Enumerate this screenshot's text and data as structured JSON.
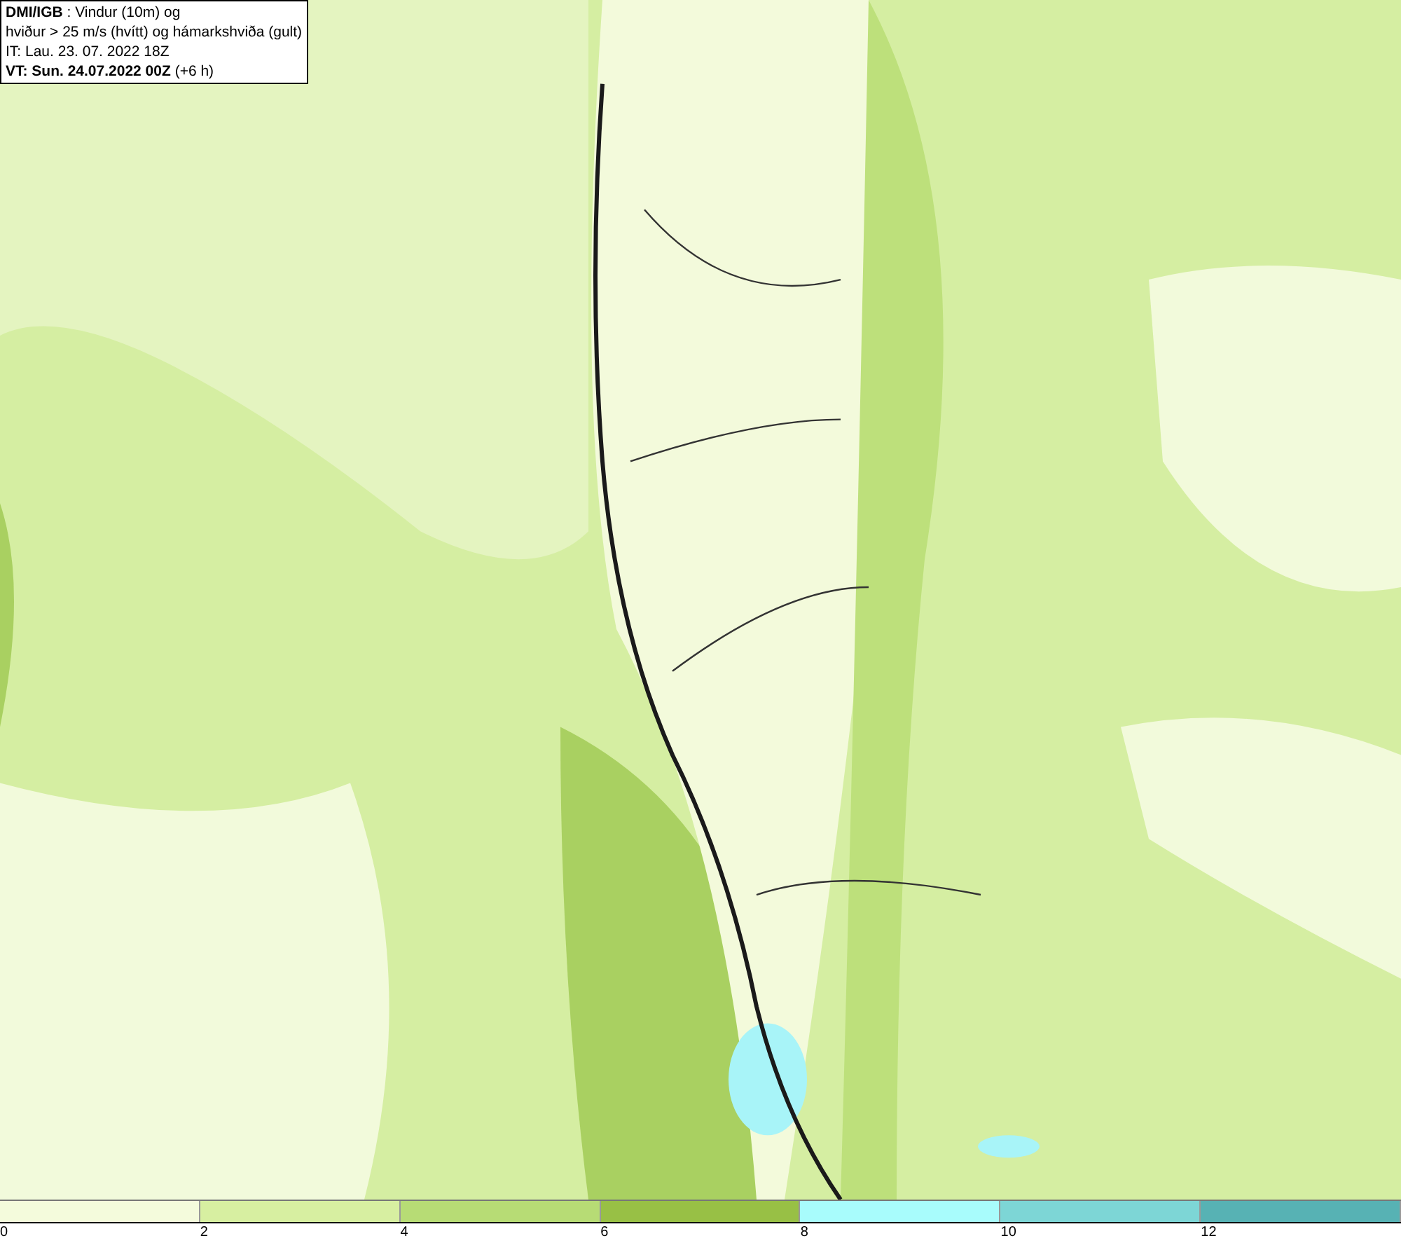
{
  "info": {
    "lines": [
      "**DMI/IGB** : Vindur (10m) og",
      "hviður > 25 m/s (hvítt) og hámarkshviða (gult)",
      "IT: Lau. 23. 07. 2022 18Z",
      "**VT: Sun. 24.07.2022 00Z** (+6 h)"
    ]
  },
  "colorbar": {
    "segments": [
      {
        "color": "#f4fbdc"
      },
      {
        "color": "#d7efa1"
      },
      {
        "color": "#b7dc75"
      },
      {
        "color": "#98c045"
      },
      {
        "color": "#a8fcfc"
      },
      {
        "color": "#7dd6d6"
      },
      {
        "color": "#57b2b4"
      }
    ],
    "ticks": [
      "0",
      "2",
      "4",
      "6",
      "8",
      "10",
      "12"
    ]
  }
}
